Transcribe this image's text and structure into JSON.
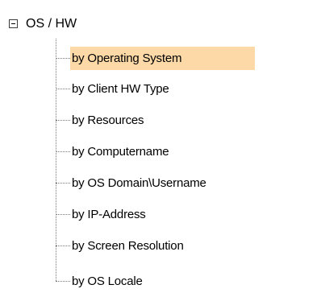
{
  "tree": {
    "root": {
      "label": "OS / HW",
      "expander_icon": "minus-box-icon",
      "expanded": true
    },
    "items": [
      {
        "label": "by Operating System",
        "selected": true
      },
      {
        "label": "by Client HW Type",
        "selected": false
      },
      {
        "label": "by Resources",
        "selected": false
      },
      {
        "label": "by Computername",
        "selected": false
      },
      {
        "label": "by OS Domain\\Username",
        "selected": false
      },
      {
        "label": "by IP-Address",
        "selected": false
      },
      {
        "label": "by Screen Resolution",
        "selected": false
      },
      {
        "label": "by OS Locale",
        "selected": false
      }
    ],
    "colors": {
      "selection": "#fcd9a6",
      "connector": "#7a7a7a"
    }
  }
}
